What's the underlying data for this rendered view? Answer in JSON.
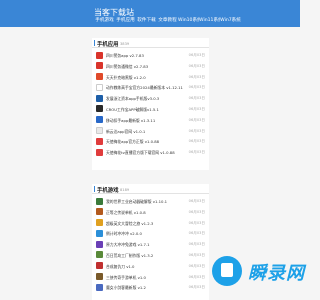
{
  "header": {
    "site_title": "当客下载站",
    "nav": [
      "手机游戏",
      "手机应用",
      "软件下载",
      "文章教程",
      "Win10系统",
      "Win11系统",
      "Win7系统"
    ]
  },
  "apps_panel": {
    "title": "手机应用",
    "count": "3839",
    "items": [
      {
        "name": "四川警务app v2.7.83",
        "date": "06月03日",
        "color": "#d9342b"
      },
      {
        "name": "四川警务通微信 v2.7.83",
        "date": "06月03日",
        "color": "#d9342b"
      },
      {
        "name": "天天扑克暗黑版 v1.2.0",
        "date": "06月03日",
        "color": "#e04a2a"
      },
      {
        "name": "动作教练高手宝官方2024最新版本 v1.12.11",
        "date": "06月03日",
        "color": "#ffffff"
      },
      {
        "name": "发展浙江资本app手机版v3.0.3",
        "date": "06月03日",
        "color": "#1e5fa8"
      },
      {
        "name": "CROU工作宝APP破解版v1.5.1",
        "date": "06月03日",
        "color": "#2a2a2a"
      },
      {
        "name": "移动扣手app最新版 v1.3.11",
        "date": "06月03日",
        "color": "#2868c8"
      },
      {
        "name": "新云达app官网 v1.0.1",
        "date": "06月03日",
        "color": "#e9e9e9"
      },
      {
        "name": "天使梅花app官方正版 v1.0.88",
        "date": "06月03日",
        "color": "#e03c3c"
      },
      {
        "name": "天使梅花tv直播官方版下载官网 v1.0.88",
        "date": "06月03日",
        "color": "#e03c3c"
      }
    ]
  },
  "games_panel": {
    "title": "手机游戏",
    "count": "8189",
    "items": [
      {
        "name": "我的世界工业启动器破解版 v1.10.1",
        "date": "06月03日",
        "color": "#3b7a3a"
      },
      {
        "name": "正等之传说单机 v1.0.8",
        "date": "06月03日",
        "color": "#b35a1e"
      },
      {
        "name": "超级英文大冒险之旅 v1.2.3",
        "date": "06月03日",
        "color": "#e0a020"
      },
      {
        "name": "倒计时冲冲冲 v2.0.0",
        "date": "06月03日",
        "color": "#2b8fd8"
      },
      {
        "name": "原力大冲冲兔游戏 v1.7.1",
        "date": "06月03日",
        "color": "#6a3fb5"
      },
      {
        "name": "百日荒岛工厂制作版 v1.3.2",
        "date": "06月03日",
        "color": "#5a8a3a"
      },
      {
        "name": "合成复仇刀 v1.0",
        "date": "06月03日",
        "color": "#c03030"
      },
      {
        "name": "三侠传奇手游单机 v1.0",
        "date": "06月03日",
        "color": "#7a5a2a"
      },
      {
        "name": "魔女小剑客最新版 v1.2",
        "date": "06月03日",
        "color": "#4a6ac0"
      }
    ]
  },
  "watermark": {
    "text": "瞬录网"
  }
}
